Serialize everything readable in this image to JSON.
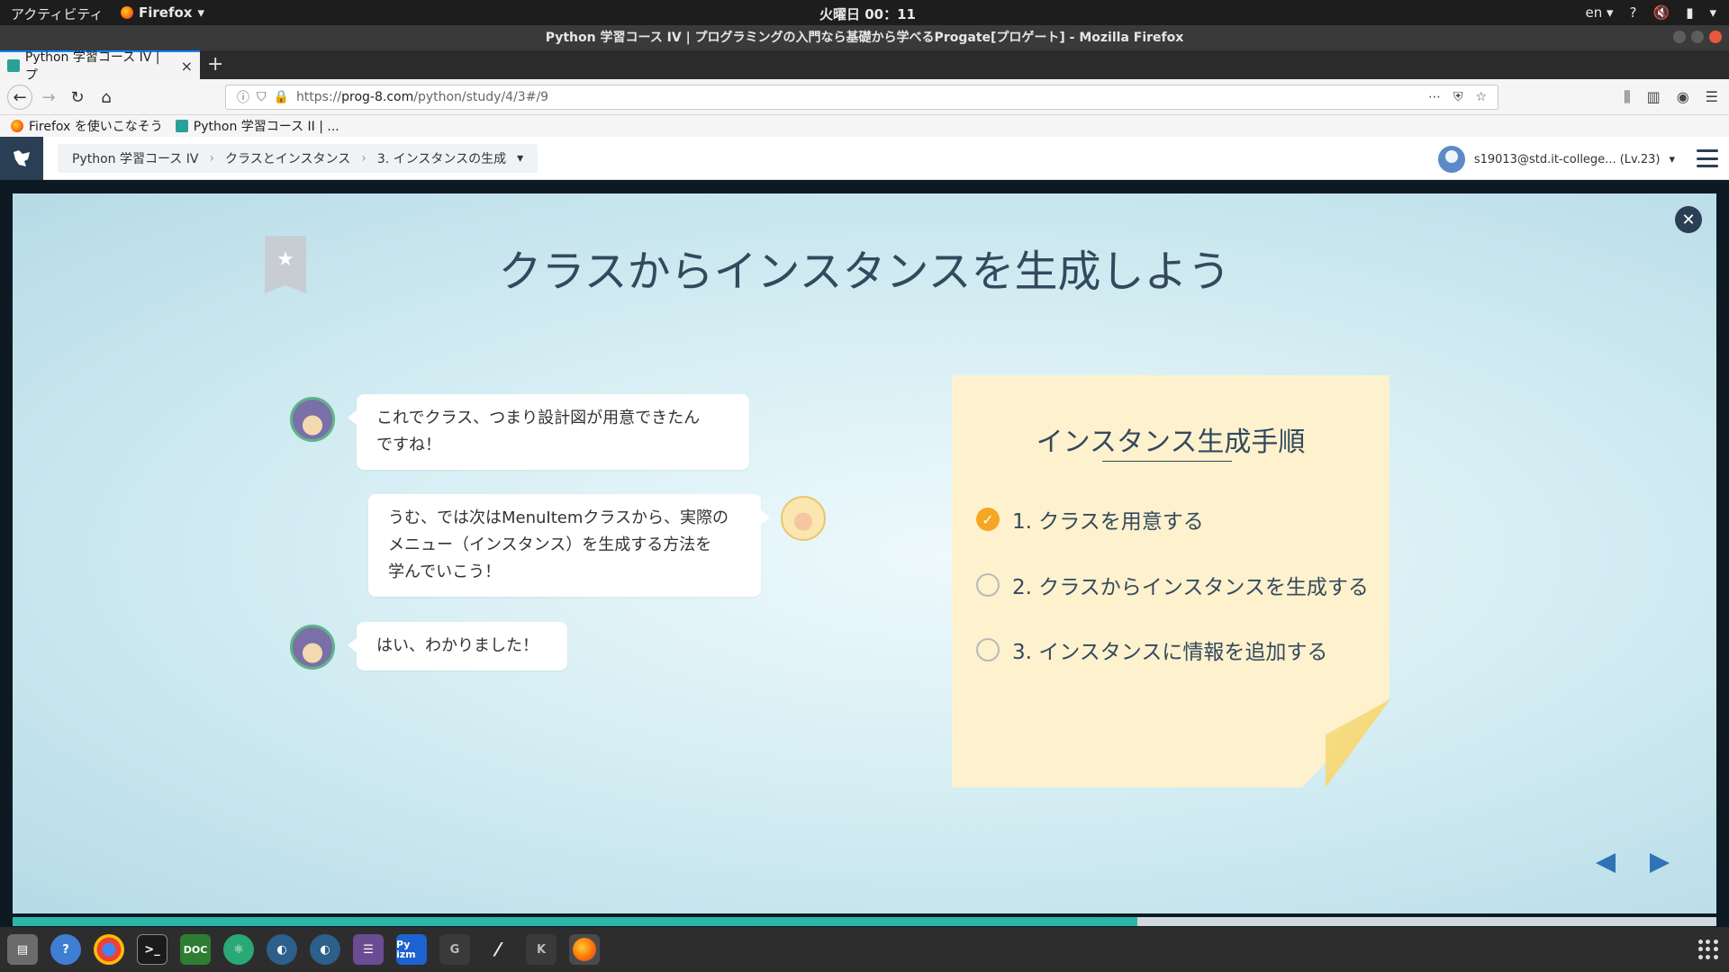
{
  "topbar": {
    "activities": "アクティビティ",
    "app_menu": "Firefox",
    "clock": "火曜日 00：11",
    "lang": "en",
    "help": "?"
  },
  "window": {
    "title": "Python 学習コース IV | プログラミングの入門なら基礎から学べるProgate[プロゲート] - Mozilla Firefox"
  },
  "tab": {
    "label": "Python 学習コース IV | プ",
    "close": "×",
    "new": "+"
  },
  "url": {
    "full": "https://prog-8.com/python/study/4/3#/9",
    "prefix": "https://",
    "host": "prog-8.com",
    "path": "/python/study/4/3#/9"
  },
  "bookmarks": [
    {
      "label": "Firefox を使いこなそう"
    },
    {
      "label": "Python 学習コース II | ..."
    }
  ],
  "header": {
    "breadcrumb": [
      "Python 学習コース IV",
      "クラスとインスタンス",
      "3. インスタンスの生成"
    ],
    "user": "s19013@std.it-college... (Lv.23)"
  },
  "slide": {
    "title": "クラスからインスタンスを生成しよう",
    "dialog": [
      {
        "speaker": "ninja",
        "text_lines": [
          "これでクラス、つまり設計図が用意できたん",
          "ですね！"
        ]
      },
      {
        "speaker": "sheep",
        "text_lines": [
          "うむ、では次はMenuItemクラスから、実際の",
          "メニュー（インスタンス）を生成する方法を",
          "学んでいこう！"
        ]
      },
      {
        "speaker": "ninja",
        "text_lines": [
          "はい、わかりました！"
        ]
      }
    ],
    "note": {
      "title": "インスタンス生成手順",
      "steps": [
        {
          "label": "1. クラスを用意する",
          "done": true
        },
        {
          "label": "2. クラスからインスタンスを生成する",
          "done": false
        },
        {
          "label": "3. インスタンスに情報を追加する",
          "done": false
        }
      ]
    },
    "progress": 0.66
  },
  "taskbar": {
    "items": [
      "files-icon",
      "help-icon",
      "chrome-icon",
      "terminal-icon",
      "DOC",
      "atom-icon",
      "eclipse-icon",
      "eclipse-2-icon",
      "editor-icon",
      "Py izm",
      "G",
      "typora-icon",
      "K",
      "firefox-icon"
    ]
  },
  "colors": {
    "accent": "#2a3f54",
    "check": "#f5a623",
    "arrow": "#2f72b8",
    "progress": "#2ab7a9"
  }
}
